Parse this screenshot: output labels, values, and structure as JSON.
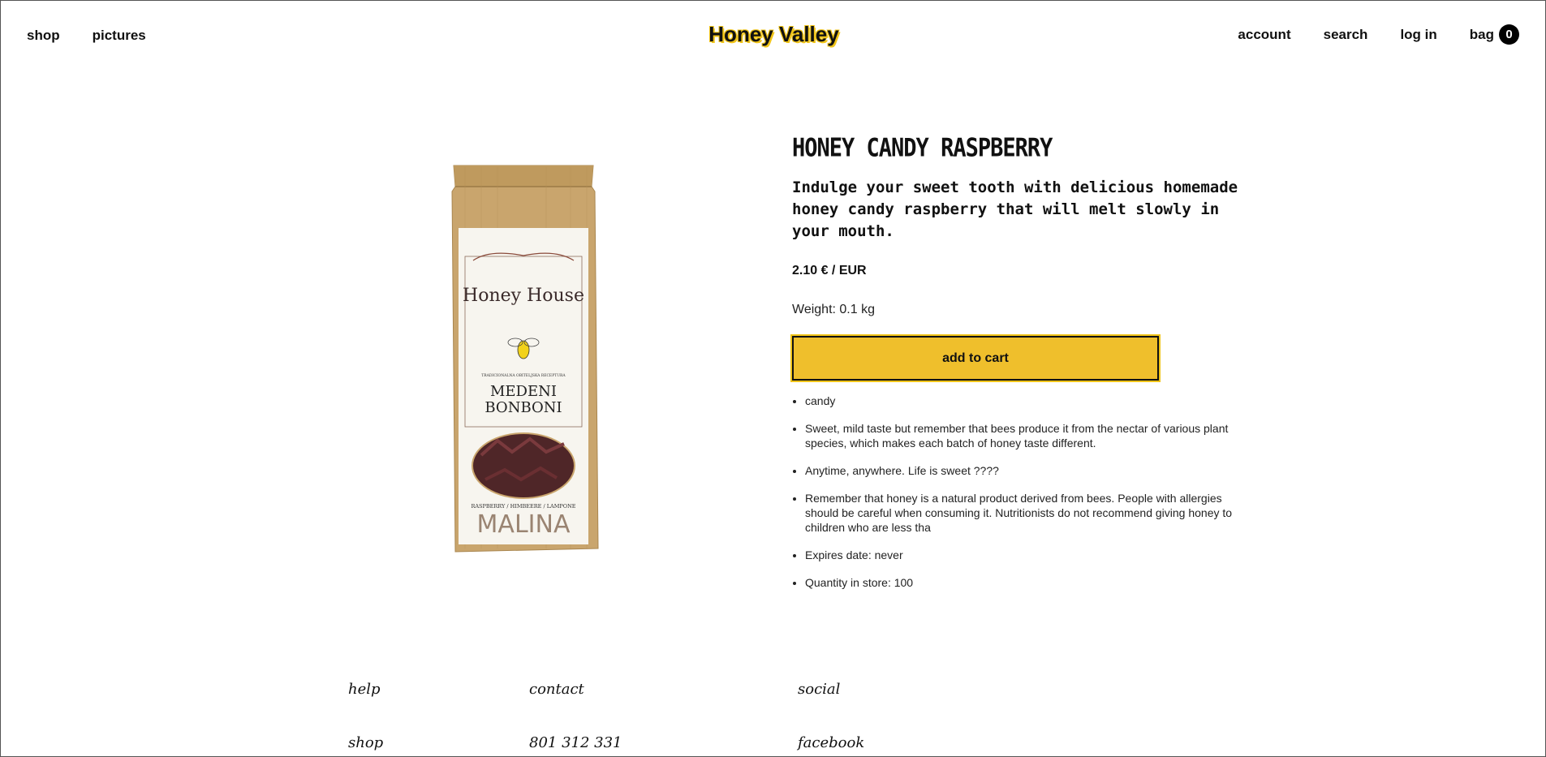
{
  "header": {
    "nav_left": [
      "shop",
      "pictures"
    ],
    "brand": "Honey Valley",
    "nav_right": [
      "account",
      "search",
      "log in"
    ],
    "bag_label": "bag",
    "bag_count": "0"
  },
  "product": {
    "title": "HONEY CANDY RASPBERRY",
    "description": "Indulge your sweet tooth with delicious homemade honey candy raspberry that will melt slowly in your mouth.",
    "price": "2.10 € / EUR",
    "weight": "Weight: 0.1 kg",
    "add_to_cart": "add to cart",
    "features": [
      "candy",
      "Sweet, mild taste but remember that bees produce it from the nectar of various plant species, which makes each batch of honey taste different.",
      "Anytime, anywhere. Life is sweet ????",
      "Remember that honey is a natural product derived from bees. People with allergies should be careful when consuming it. Nutritionists do not recommend giving honey to children who are less tha",
      "Expires date: never",
      "Quantity in store: 100"
    ],
    "package": {
      "brand": "Honey House",
      "tagline": "TRADICIONALNA OBITELJSKA RECEPTURA",
      "name_line1": "MEDENI",
      "name_line2": "BONBONI",
      "flavors": "RASPBERRY / HIMBEERE / LAMPONE",
      "flavor_name": "MALINA"
    }
  },
  "footer": {
    "columns": [
      {
        "heading": "help",
        "link": "shop"
      },
      {
        "heading": "contact",
        "link": "801 312 331"
      },
      {
        "heading": "social",
        "link": "facebook"
      }
    ]
  },
  "colors": {
    "accent": "#efbf2c",
    "kraft": "#c9a56d",
    "candy": "#5a2a2c"
  }
}
